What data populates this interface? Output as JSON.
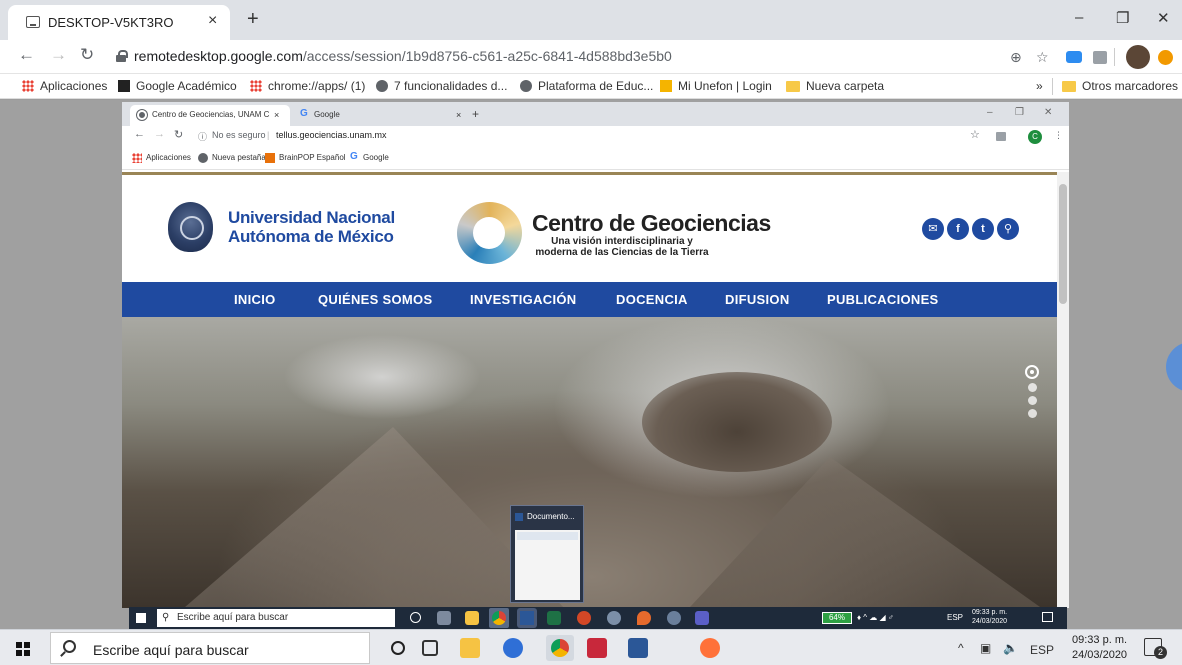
{
  "outer_browser": {
    "tab_title": "DESKTOP-V5KT3RO",
    "tab_close": "×",
    "new_tab": "+",
    "window_controls": [
      "–",
      "❐",
      "✕"
    ],
    "url_host": "remotedesktop.google.com",
    "url_path": "/access/session/1b9d8756-c561-a25c-6841-4d588bd3e5b0",
    "bookmarks": [
      {
        "label": "Aplicaciones",
        "icon": "apps-grid-icon"
      },
      {
        "label": "Google Académico",
        "icon": "scholar-icon"
      },
      {
        "label": "chrome://apps/ (1)",
        "icon": "apps-grid-icon"
      },
      {
        "label": "7 funcionalidades d...",
        "icon": "globe-icon"
      },
      {
        "label": "Plataforma de Educ...",
        "icon": "globe-icon"
      },
      {
        "label": "Mi Unefon | Login",
        "icon": "unefon-icon"
      },
      {
        "label": "Nueva carpeta",
        "icon": "folder-icon"
      }
    ],
    "bookmarks_more": "»",
    "other_bookmarks": "Otros marcadores"
  },
  "inner_browser": {
    "tabs": [
      {
        "label": "Centro de Geociencias, UNAM C",
        "close": "×"
      },
      {
        "label": "Google",
        "close": "×"
      }
    ],
    "new_tab": "+",
    "security": "No es seguro",
    "url": "tellus.geociencias.unam.mx",
    "profile_initial": "C",
    "bookmarks": [
      "Aplicaciones",
      "Nueva pestaña",
      "BrainPOP Español",
      "Google"
    ]
  },
  "site": {
    "unam_line1": "Universidad Nacional",
    "unam_line2": "Autónoma de México",
    "center_title": "Centro de Geociencias",
    "center_sub1": "Una visión interdisciplinaria y",
    "center_sub2": "moderna de las Ciencias de la Tierra",
    "social": [
      {
        "icon": "email-icon",
        "glyph": "✉"
      },
      {
        "icon": "facebook-icon",
        "glyph": "f"
      },
      {
        "icon": "twitter-icon",
        "glyph": "t"
      },
      {
        "icon": "location-icon",
        "glyph": "⚲"
      }
    ],
    "nav": [
      "INICIO",
      "QUIÉNES SOMOS",
      "INVESTIGACIÓN",
      "DOCENCIA",
      "DIFUSION",
      "PUBLICACIONES"
    ],
    "brand_color": "#1f4aa0"
  },
  "remote_taskbar": {
    "search_placeholder": "Escribe aquí para buscar",
    "battery": "64%",
    "lang": "ESP",
    "time": "09:33 p. m.",
    "date": "24/03/2020",
    "preview_title": "Documento..."
  },
  "taskbar": {
    "search_placeholder": "Escribe aquí para buscar",
    "lang": "ESP",
    "time": "09:33 p. m.",
    "date": "24/03/2020",
    "notifications": "2"
  }
}
